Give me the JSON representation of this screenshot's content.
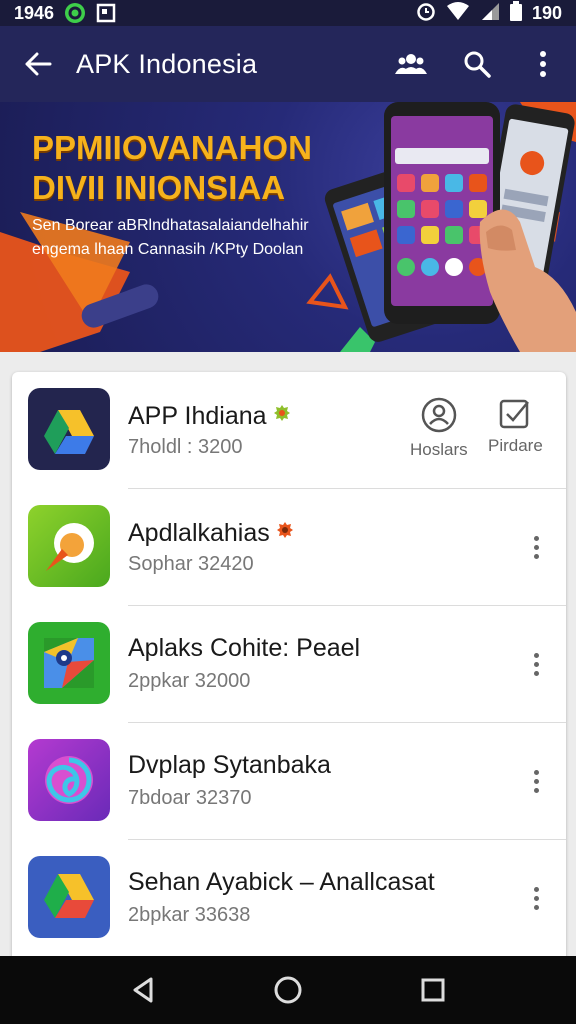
{
  "status_bar": {
    "time": "1946",
    "battery_text": "190"
  },
  "app_bar": {
    "title": "APK Indonesia"
  },
  "banner": {
    "headline_1": "PPMIIOVANAHON",
    "headline_2": "DIVII INIONSIAA",
    "subtitle_1": "Sen Borear aBRlndhatasalaiandelhahir",
    "subtitle_2": "engema lhaan Cannasih /KPty Doolan"
  },
  "apps": [
    {
      "name": "APP Ihdiana",
      "meta": "7holdl : 3200",
      "actions": [
        {
          "label": "Hoslars",
          "icon": "people-search-icon"
        },
        {
          "label": "Pirdare",
          "icon": "checkbox-icon"
        }
      ]
    },
    {
      "name": "Apdlalkahias",
      "meta": "Sophar 32420"
    },
    {
      "name": "Aplaks Cohite: Peael",
      "meta": "2ppkar 32000"
    },
    {
      "name": "Dvplap Sytanbaka",
      "meta": "7bdoar 32370"
    },
    {
      "name": "Sehan Ayabick – Anallcasat",
      "meta": "2bpkar 33638"
    }
  ],
  "colors": {
    "app_bar": "#24265a",
    "status_bar": "#1a1b3a",
    "headline": "#f6b21c",
    "nav_bar": "#0a0a0a"
  }
}
